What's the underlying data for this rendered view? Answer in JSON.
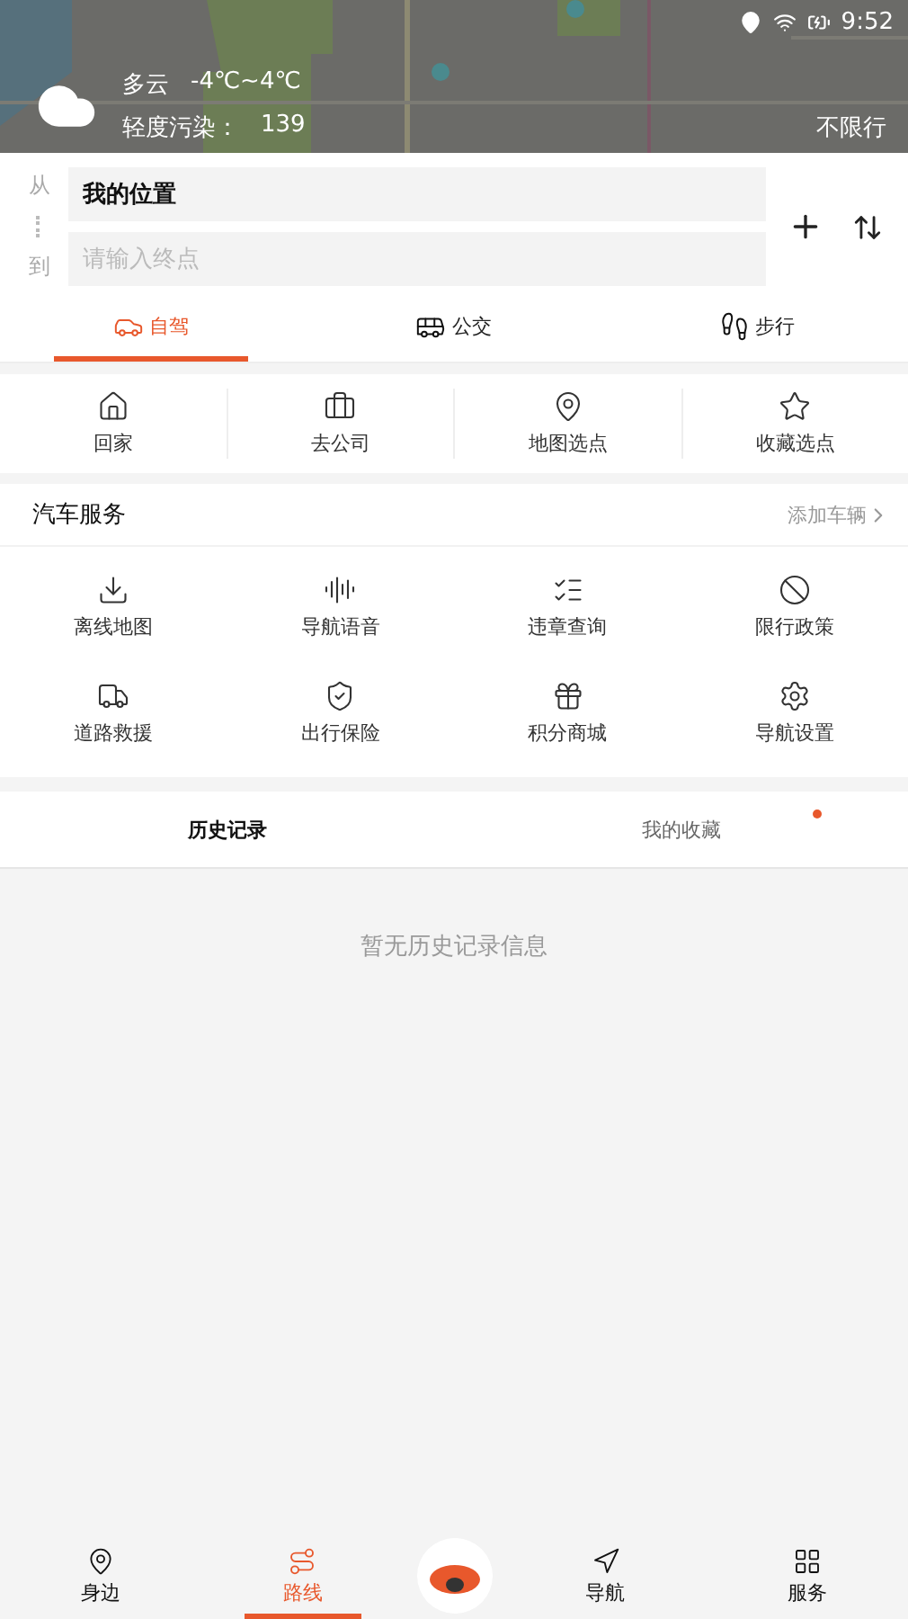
{
  "status_bar": {
    "time": "9:52"
  },
  "weather": {
    "condition": "多云",
    "temperature": "-4℃~4℃",
    "pollution_label": "轻度污染：",
    "pollution_value": "139",
    "restriction": "不限行"
  },
  "route": {
    "from_label": "从",
    "to_label": "到",
    "from_value": "我的位置",
    "to_placeholder": "请输入终点"
  },
  "modes": [
    {
      "label": "自驾",
      "selected": true
    },
    {
      "label": "公交",
      "selected": false
    },
    {
      "label": "步行",
      "selected": false
    }
  ],
  "shortcuts": [
    {
      "label": "回家"
    },
    {
      "label": "去公司"
    },
    {
      "label": "地图选点"
    },
    {
      "label": "收藏选点"
    }
  ],
  "car_services": {
    "title": "汽车服务",
    "action": "添加车辆",
    "items": [
      {
        "label": "离线地图"
      },
      {
        "label": "导航语音"
      },
      {
        "label": "违章查询"
      },
      {
        "label": "限行政策"
      },
      {
        "label": "道路救援"
      },
      {
        "label": "出行保险"
      },
      {
        "label": "积分商城"
      },
      {
        "label": "导航设置"
      }
    ]
  },
  "record_tabs": [
    {
      "label": "历史记录",
      "selected": true,
      "badge": false
    },
    {
      "label": "我的收藏",
      "selected": false,
      "badge": true
    }
  ],
  "empty_message": "暂无历史记录信息",
  "bottom_nav": [
    {
      "label": "身边",
      "selected": false
    },
    {
      "label": "路线",
      "selected": true
    },
    {
      "label": "导航",
      "selected": false
    },
    {
      "label": "服务",
      "selected": false
    }
  ]
}
